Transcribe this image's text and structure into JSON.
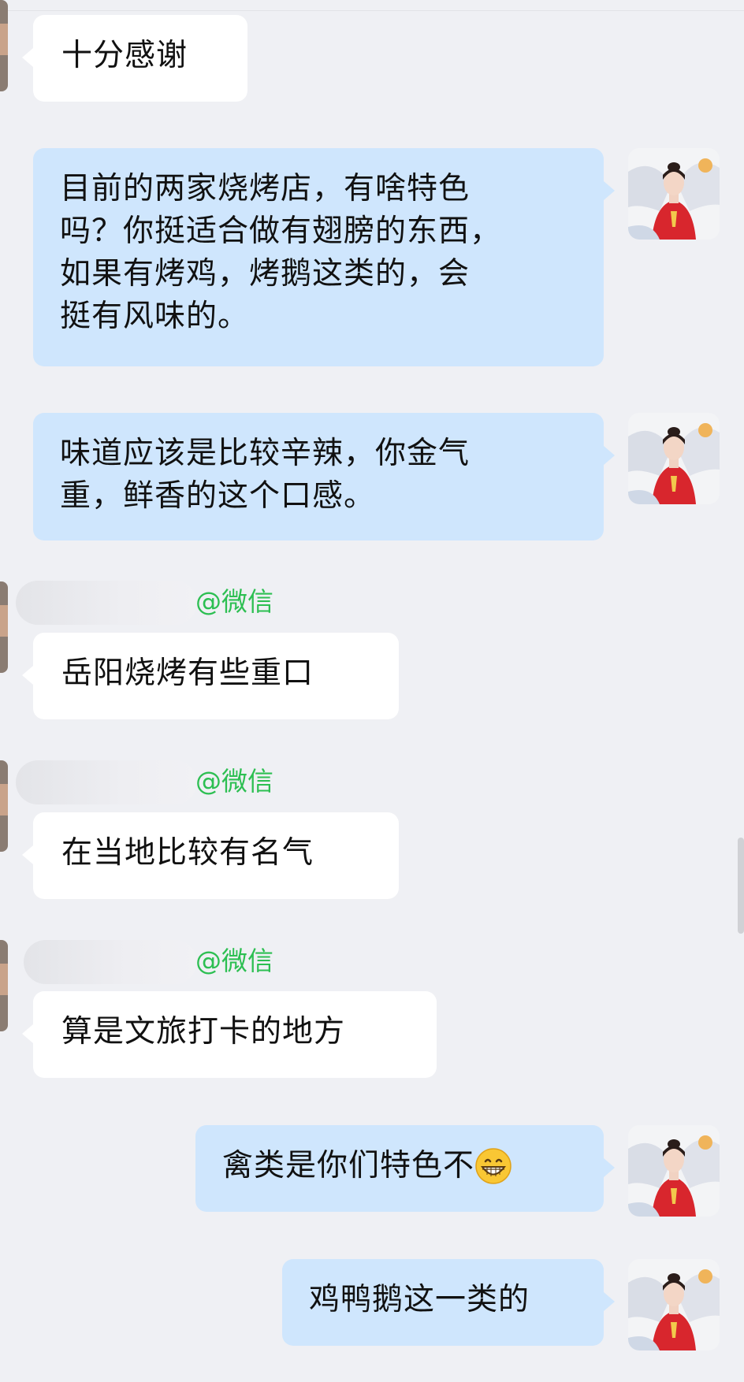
{
  "messages": [
    {
      "sender": "other",
      "lines": [
        "十分感谢"
      ]
    },
    {
      "sender": "self",
      "lines": [
        "目前的两家烧烤店，有啥特色",
        "吗？你挺适合做有翅膀的东西，",
        "如果有烤鸡，烤鹅这类的，会",
        "挺有风味的。"
      ]
    },
    {
      "sender": "self",
      "lines": [
        "味道应该是比较辛辣，你金气",
        "重，鲜香的这个口感。"
      ]
    },
    {
      "sender": "other",
      "tag": "@微信",
      "lines": [
        "岳阳烧烤有些重口"
      ]
    },
    {
      "sender": "other",
      "tag": "@微信",
      "lines": [
        "在当地比较有名气"
      ]
    },
    {
      "sender": "other",
      "tag": "@微信",
      "lines": [
        "算是文旅打卡的地方"
      ]
    },
    {
      "sender": "self",
      "lines": [
        "禽类是你们特色不"
      ],
      "emoji": "grinning-face-icon"
    },
    {
      "sender": "self",
      "lines": [
        "鸡鸭鹅这一类的"
      ]
    }
  ],
  "colors": {
    "background": "#eff0f4",
    "bubble_in": "#ffffff",
    "bubble_out": "#cfe6fd",
    "sender_tag": "#2dbf52"
  }
}
